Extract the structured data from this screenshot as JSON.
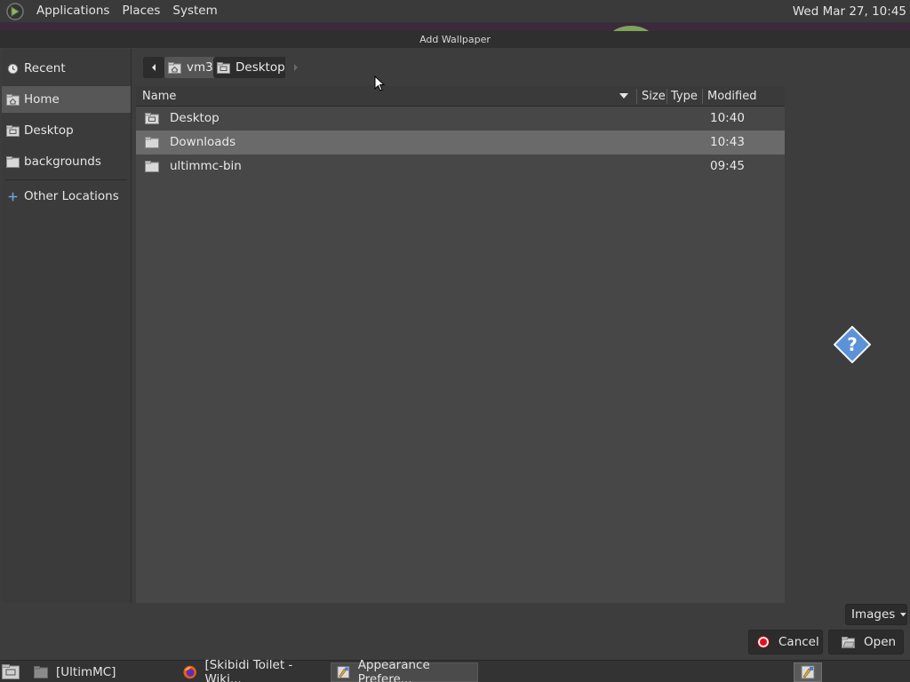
{
  "top_panel": {
    "menus": [
      "Applications",
      "Places",
      "System"
    ],
    "clock": "Wed Mar 27, 10:45"
  },
  "dialog": {
    "title": "Add Wallpaper",
    "sidebar": {
      "items": [
        {
          "label": "Recent",
          "icon": "recent-icon",
          "selected": false
        },
        {
          "label": "Home",
          "icon": "home-folder-icon",
          "selected": true
        },
        {
          "label": "Desktop",
          "icon": "desktop-folder-icon",
          "selected": false
        },
        {
          "label": "backgrounds",
          "icon": "folder-icon",
          "selected": false
        }
      ],
      "other_locations": "Other Locations"
    },
    "pathbar": {
      "crumbs": [
        "vm3",
        "Desktop"
      ]
    },
    "columns": {
      "name": "Name",
      "size": "Size",
      "type": "Type",
      "modified": "Modified"
    },
    "files": [
      {
        "name": "Desktop",
        "modified": "10:40",
        "icon": "desktop-folder-icon",
        "selected": false
      },
      {
        "name": "Downloads",
        "modified": "10:43",
        "icon": "folder-icon",
        "selected": true
      },
      {
        "name": "ultimmc-bin",
        "modified": "09:45",
        "icon": "folder-icon",
        "selected": false
      }
    ],
    "filter": "Images",
    "buttons": {
      "cancel": "Cancel",
      "open": "Open"
    }
  },
  "taskbar": {
    "tasks": [
      {
        "label": "[UltimMC]",
        "icon": "folder-icon",
        "active": false
      },
      {
        "label": "[Skibidi Toilet - Wiki...",
        "icon": "firefox-icon",
        "active": false
      },
      {
        "label": "Appearance Prefere...",
        "icon": "appearance-icon",
        "active": true
      }
    ]
  },
  "colors": {
    "selection": "#6a6a6a",
    "panel": "#3a3a3a",
    "dialog_bg": "#3d3d3d",
    "list_bg": "#474747",
    "cancel_dot": "#e0121f"
  }
}
